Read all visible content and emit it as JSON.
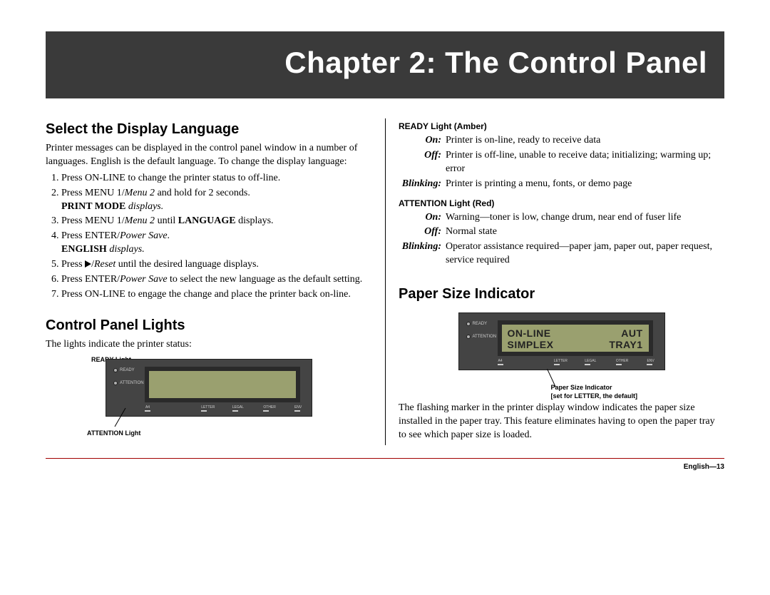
{
  "banner": {
    "title": "Chapter 2: The Control Panel"
  },
  "left": {
    "h_lang": "Select the Display Language",
    "p_lang": "Printer messages can be displayed in the control panel window in a number of languages. English is the default language. To change the display language:",
    "steps": {
      "s1": "Press ON-LINE to change the printer status to off-line.",
      "s2a": "Press MENU 1/",
      "s2b": "Menu 2",
      "s2c": " and hold for 2 seconds.",
      "s2d_bold": "PRINT MODE",
      "s2d_rest": " displays.",
      "s3a": "Press MENU 1/",
      "s3b": "Menu 2",
      "s3c": " until ",
      "s3d": "LANGUAGE",
      "s3e": " displays.",
      "s4a": "Press ENTER/",
      "s4b": "Power Save",
      "s4c": ".",
      "s4d_bold": "ENGLISH",
      "s4d_rest": " displays.",
      "s5a": "Press ",
      "s5b": "/",
      "s5c": "Reset",
      "s5d": " until the desired language displays.",
      "s6a": "Press ENTER/",
      "s6b": "Power Save",
      "s6c": " to select the new language as the default setting.",
      "s7": "Press ON-LINE to engage the change and place the printer back on-line."
    },
    "h_lights": "Control Panel Lights",
    "p_lights": "The lights indicate the printer status:",
    "callouts": {
      "ready": "READY Light",
      "attn": "ATTENTION Light"
    }
  },
  "right": {
    "h_ready": "READY Light (Amber)",
    "ready": {
      "on_l": "On:",
      "on_v": "Printer is on-line, ready to receive data",
      "off_l": "Off:",
      "off_v": "Printer is off-line, unable to receive data; initializing; warming up; error",
      "bl_l": "Blinking:",
      "bl_v": "Printer is printing a menu, fonts, or demo page"
    },
    "h_attn": "ATTENTION Light (Red)",
    "attn": {
      "on_l": "On:",
      "on_v": "Warning—toner is low, change drum, near end of fuser life",
      "off_l": "Off:",
      "off_v": "Normal state",
      "bl_l": "Blinking:",
      "bl_v": "Operator assistance required—paper jam, paper out, paper request, service required"
    },
    "h_psi": "Paper Size Indicator",
    "panel2": {
      "led1": "READY",
      "led2": "ATTENTION",
      "l1a": "ON-LINE",
      "l1b": "AUT",
      "l2a": "SIMPLEX",
      "l2b": "TRAY1",
      "r1": "A4",
      "r2": "LETTER",
      "r3": "LEGAL",
      "r4": "OTHER",
      "r5": "ENV"
    },
    "callouts2": {
      "a": "Paper Size Indicator",
      "b": "[set for LETTER, the default]"
    },
    "p_psi": "The flashing marker in the printer display window indicates the paper size installed in the paper tray. This feature eliminates having to open the paper tray to see which paper size is loaded."
  },
  "footer": {
    "text": "English—13"
  }
}
